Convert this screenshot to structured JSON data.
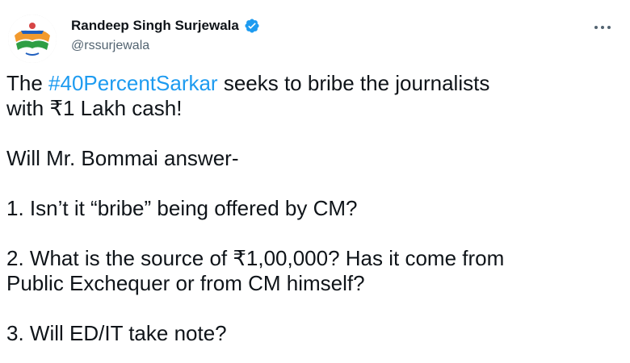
{
  "author": {
    "display_name": "Randeep Singh Surjewala",
    "handle": "@rssurjewala",
    "verified_icon": "verified-badge-icon",
    "avatar_icon": "campaign-logo-avatar",
    "more_icon": "more-options-icon"
  },
  "tweet": {
    "line1_prefix": "The ",
    "hashtag": "#40PercentSarkar",
    "line1_suffix": " seeks to bribe the journalists",
    "line2": "with ₹1 Lakh cash!",
    "question_intro": "Will Mr. Bommai answer-",
    "q1": "1. Isn’t it “bribe” being offered by CM?",
    "q2_line1": "2. What is the source of ₹1,00,000? Has it come from",
    "q2_line2": "Public Exchequer or from CM himself?",
    "q3": "3. Will ED/IT take note?"
  },
  "colors": {
    "link": "#1d9bf0",
    "text": "#0f1419",
    "secondary": "#536471"
  }
}
